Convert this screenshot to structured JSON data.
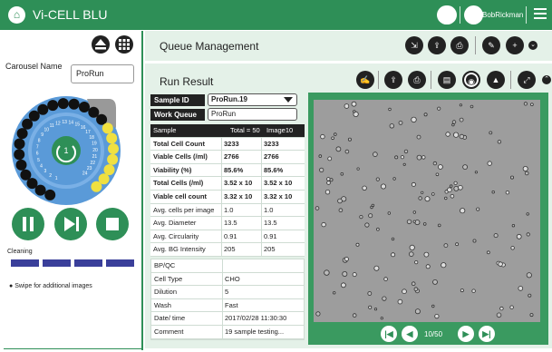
{
  "app": {
    "title": "Vi-CELL BLU"
  },
  "user": {
    "name": "BobRickman"
  },
  "left": {
    "carousel_label": "Carousel Name",
    "carousel_name": "ProRun",
    "cleaning_label": "Cleaning",
    "swipe_hint": "Swipe for additional images",
    "carousel_numbers": [
      "1",
      "2",
      "3",
      "4",
      "5",
      "6",
      "7",
      "8",
      "9",
      "10",
      "11",
      "12",
      "13",
      "14",
      "15",
      "16",
      "17",
      "18",
      "19",
      "20",
      "21",
      "22",
      "23",
      "24"
    ],
    "current_position": "1"
  },
  "queue": {
    "title": "Queue Management"
  },
  "run": {
    "title": "Run Result"
  },
  "sample": {
    "id_label": "Sample ID",
    "id_value": "ProRun.19",
    "queue_label": "Work Queue",
    "queue_value": "ProRun"
  },
  "table": {
    "headers": [
      "Sample",
      "Total = 50",
      "Image10"
    ],
    "rows": [
      {
        "label": "Total Cell Count",
        "total": "3233",
        "image": "3233",
        "bold": true
      },
      {
        "label": "Viable Cells (/ml)",
        "total": "2766",
        "image": "2766",
        "bold": true
      },
      {
        "label": "Viability (%)",
        "total": "85.6%",
        "image": "85.6%",
        "bold": true
      },
      {
        "label": "Total Cells (/ml)",
        "total": "3.52 x 10",
        "image": "3.52 x 10",
        "bold": true
      },
      {
        "label": "Viable cell count",
        "total": "3.32 x 10",
        "image": "3.32 x 10",
        "bold": true
      },
      {
        "label": "Avg. cells per image",
        "total": "1.0",
        "image": "1.0",
        "bold": false
      },
      {
        "label": "Avg. Diameter",
        "total": "13.5",
        "image": "13.5",
        "bold": false
      },
      {
        "label": "Avg. Circularity",
        "total": "0.91",
        "image": "0.91",
        "bold": false
      },
      {
        "label": "Avg. BG Intensity",
        "total": "205",
        "image": "205",
        "bold": false
      }
    ]
  },
  "bpqc": {
    "rows": [
      {
        "label": "BP/QC",
        "value": ""
      },
      {
        "label": "Cell Type",
        "value": "CHO"
      },
      {
        "label": "Dilution",
        "value": "5"
      },
      {
        "label": "Wash",
        "value": "Fast"
      },
      {
        "label": "Date/ time",
        "value": "2017/02/28 11:30:30"
      },
      {
        "label": "Comment",
        "value": "19 sample testing..."
      }
    ]
  },
  "image_nav": {
    "page": "10/50"
  },
  "colors": {
    "brand": "#2e8f57",
    "panel": "#3a9a60",
    "pale": "#e8f3ec",
    "yellow": "#f0e040",
    "cleaning": "#3a3f9a"
  }
}
